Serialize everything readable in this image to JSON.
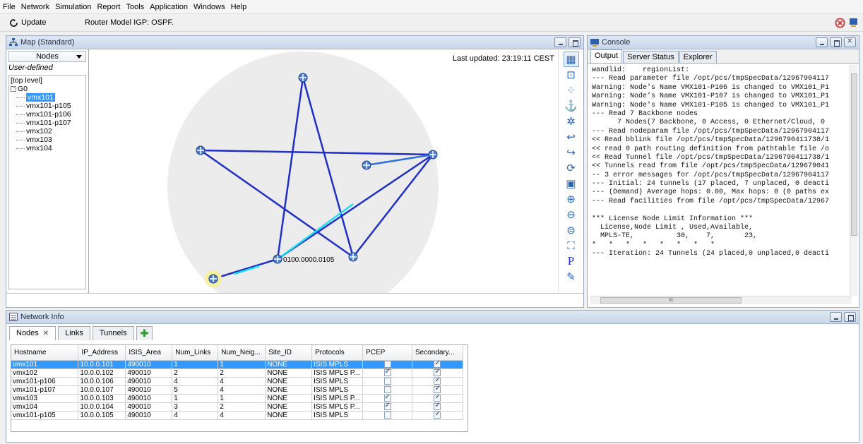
{
  "menu": [
    "File",
    "Network",
    "Simulation",
    "Report",
    "Tools",
    "Application",
    "Windows",
    "Help"
  ],
  "toolbar": {
    "update_label": "Update",
    "router_model": "Router Model IGP: OSPF."
  },
  "map": {
    "title": "Map (Standard)",
    "nodes_dropdown": "Nodes",
    "user_defined": "User-defined",
    "last_updated": "Last updated: 23:19:11 CEST",
    "tree": {
      "top": "[top level]",
      "group": "G0",
      "items": [
        "vmx101",
        "vmx101-p105",
        "vmx101-p106",
        "vmx101-p107",
        "vmx102",
        "vmx103",
        "vmx104"
      ],
      "selected": "vmx101"
    },
    "node_label": "0100.0000.0105"
  },
  "console": {
    "title": "Console",
    "tabs": [
      "Output",
      "Server Status",
      "Explorer"
    ],
    "lines": [
      "wandlid:    regionList:",
      "--- Read parameter file /opt/pcs/tmpSpecData/12967904117",
      "Warning: Node's Name VMX101-P106 is changed to VMX101_P1",
      "Warning: Node's Name VMX101-P107 is changed to VMX101_P1",
      "Warning: Node's Name VMX101-P105 is changed to VMX101_P1",
      "--- Read 7 Backbone nodes",
      "      7 Nodes(7 Backbone, 0 Access, 0 Ethernet/Cloud, 0",
      "--- Read nodeparam file /opt/pcs/tmpSpecData/12967904117",
      "<< Read bblink file /opt/pcs/tmpSpecData/1296790411738/1",
      "<< read 0 path routing definition from pathtable file /o",
      "<< Read Tunnel file /opt/pcs/tmpSpecData/1296790411738/1",
      "<< Tunnels read from file /opt/pcs/tmpSpecData/129679041",
      "-- 3 error messages for /opt/pcs/tmpSpecData/12967904117",
      "--- Initial: 24 tunnels (17 placed, 7 unplaced, 0 deacti",
      "--- (Demand) Average hops: 0.00, Max hops: 0 (0 paths ex",
      "--- Read facilities from file /opt/pcs/tmpSpecData/12967",
      "",
      "*** License Node Limit Information ***",
      "  License,Node Limit , Used,Available,",
      "  MPLS-TE,          30,    7,       23,",
      "*   *   *   *   *   *   *   *",
      "--- Iteration: 24 Tunnels (24 placed,0 unplaced,0 deacti"
    ],
    "scroll_grip": "III"
  },
  "netinfo": {
    "title": "Network Info",
    "tabs": [
      "Nodes",
      "Links",
      "Tunnels"
    ],
    "columns": [
      "Hostname",
      "IP_Address",
      "ISIS_Area",
      "Num_Links",
      "Num_Neig...",
      "Site_ID",
      "Protocols",
      "PCEP",
      "Secondary..."
    ],
    "rows": [
      {
        "hostname": "vmx101",
        "ip": "10.0.0.101",
        "area": "490010",
        "links": "1",
        "neigh": "1",
        "site": "NONE",
        "proto": "ISIS MPLS",
        "pcep": false,
        "secondary": true
      },
      {
        "hostname": "vmx102",
        "ip": "10.0.0.102",
        "area": "490010",
        "links": "2",
        "neigh": "2",
        "site": "NONE",
        "proto": "ISIS MPLS P...",
        "pcep": true,
        "secondary": true
      },
      {
        "hostname": "vmx101-p106",
        "ip": "10.0.0.106",
        "area": "490010",
        "links": "4",
        "neigh": "4",
        "site": "NONE",
        "proto": "ISIS MPLS",
        "pcep": false,
        "secondary": true
      },
      {
        "hostname": "vmx101-p107",
        "ip": "10.0.0.107",
        "area": "490010",
        "links": "5",
        "neigh": "4",
        "site": "NONE",
        "proto": "ISIS MPLS",
        "pcep": false,
        "secondary": true
      },
      {
        "hostname": "vmx103",
        "ip": "10.0.0.103",
        "area": "490010",
        "links": "1",
        "neigh": "1",
        "site": "NONE",
        "proto": "ISIS MPLS P...",
        "pcep": true,
        "secondary": true
      },
      {
        "hostname": "vmx104",
        "ip": "10.0.0.104",
        "area": "490010",
        "links": "3",
        "neigh": "2",
        "site": "NONE",
        "proto": "ISIS MPLS P...",
        "pcep": true,
        "secondary": true
      },
      {
        "hostname": "vmx101-p105",
        "ip": "10.0.0.105",
        "area": "490010",
        "links": "4",
        "neigh": "4",
        "site": "NONE",
        "proto": "ISIS MPLS",
        "pcep": false,
        "secondary": true
      }
    ]
  }
}
